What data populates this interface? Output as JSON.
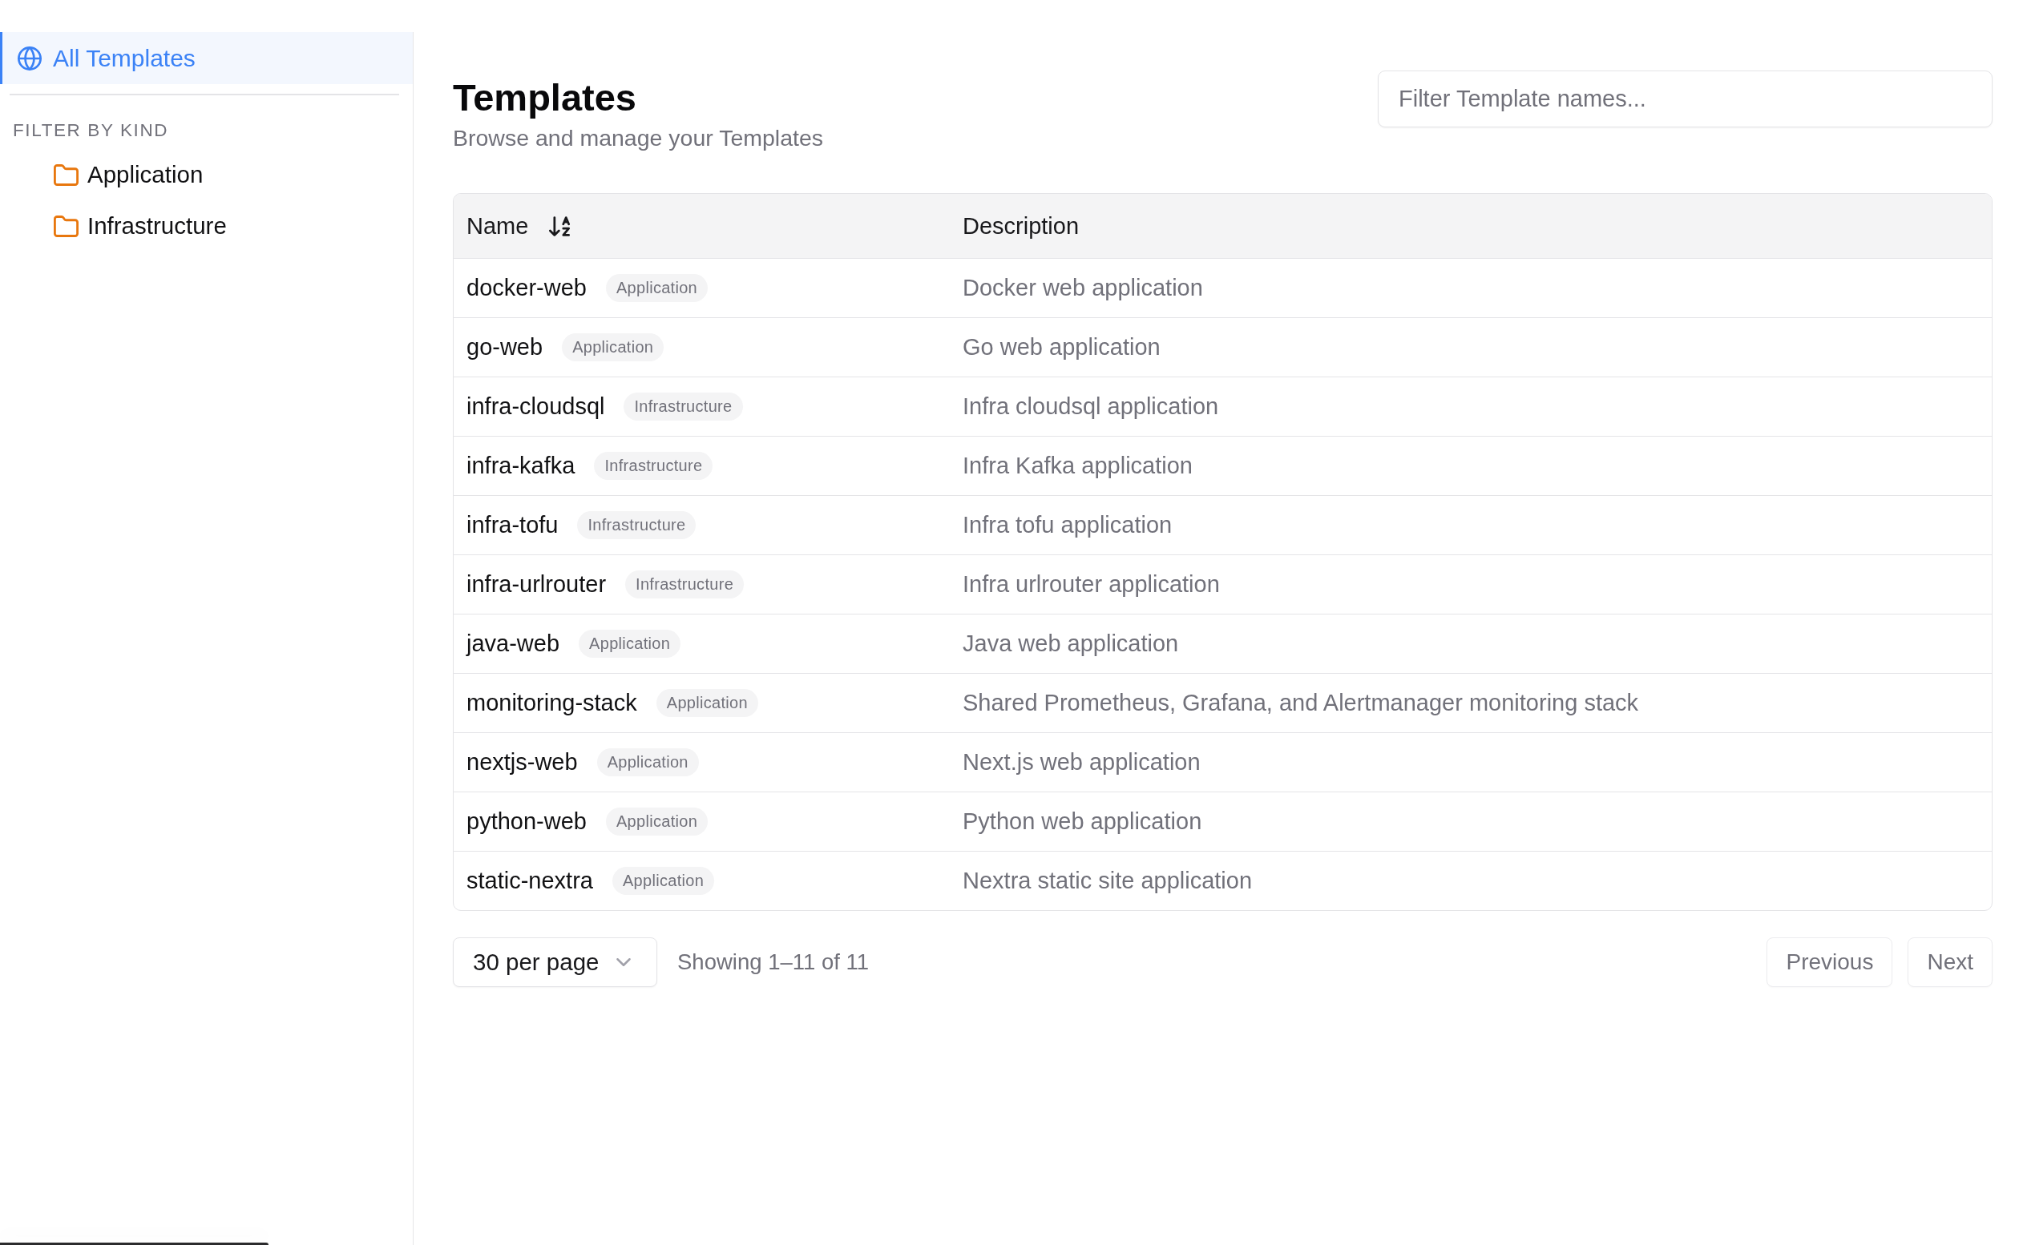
{
  "sidebar": {
    "nav": [
      {
        "label": "All Templates",
        "selected": true
      }
    ],
    "filter_heading": "FILTER BY KIND",
    "filters": [
      {
        "label": "Application",
        "selected": false
      },
      {
        "label": "Infrastructure",
        "selected": false
      }
    ]
  },
  "header": {
    "title": "Templates",
    "subtitle": "Browse and manage your Templates"
  },
  "search": {
    "placeholder": "Filter Template names..."
  },
  "table": {
    "columns": [
      {
        "label": "Name",
        "sorted": true
      },
      {
        "label": "Description",
        "sorted": false
      }
    ],
    "rows": [
      {
        "name": "docker-web",
        "badge": "Application",
        "description": "Docker web application"
      },
      {
        "name": "go-web",
        "badge": "Application",
        "description": "Go web application"
      },
      {
        "name": "infra-cloudsql",
        "badge": "Infrastructure",
        "description": "Infra cloudsql application"
      },
      {
        "name": "infra-kafka",
        "badge": "Infrastructure",
        "description": "Infra Kafka application"
      },
      {
        "name": "infra-tofu",
        "badge": "Infrastructure",
        "description": "Infra tofu application"
      },
      {
        "name": "infra-urlrouter",
        "badge": "Infrastructure",
        "description": "Infra urlrouter application"
      },
      {
        "name": "java-web",
        "badge": "Application",
        "description": "Java web application"
      },
      {
        "name": "monitoring-stack",
        "badge": "Application",
        "description": "Shared Prometheus, Grafana, and Alertmanager monitoring stack"
      },
      {
        "name": "nextjs-web",
        "badge": "Application",
        "description": "Next.js web application"
      },
      {
        "name": "python-web",
        "badge": "Application",
        "description": "Python web application"
      },
      {
        "name": "static-nextra",
        "badge": "Application",
        "description": "Nextra static site application"
      }
    ]
  },
  "pagination": {
    "page_size": "30 per page",
    "summary": "Showing 1–11 of 11",
    "buttons": [
      {
        "label": "Previous",
        "disabled": true
      },
      {
        "label": "Next",
        "disabled": true
      }
    ]
  }
}
